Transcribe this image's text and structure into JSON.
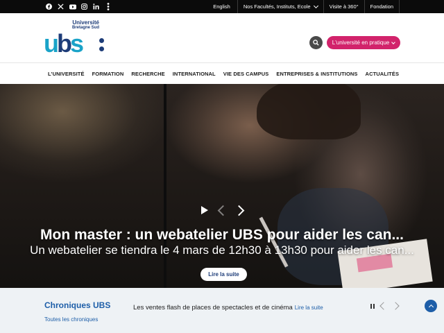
{
  "topbar": {
    "social": [
      "facebook-icon",
      "x-icon",
      "youtube-icon",
      "instagram-icon",
      "linkedin-icon",
      "more-icon"
    ],
    "links": [
      {
        "label": "English"
      },
      {
        "label": "Nos Facultés, Instituts, Ecole"
      },
      {
        "label": "Visite à 360°"
      },
      {
        "label": "Fondation"
      }
    ]
  },
  "header": {
    "logo": {
      "line1": "Université",
      "line2": "Bretagne Sud",
      "word_u": "u",
      "word_b": "b",
      "word_s": "s"
    },
    "cta_label": "L'université en pratique"
  },
  "nav": {
    "items": [
      "L'UNIVERSITÉ",
      "FORMATION",
      "RECHERCHE",
      "INTERNATIONAL",
      "VIE DES CAMPUS",
      "ENTREPRISES & INSTITUTIONS",
      "ACTUALITÉS"
    ]
  },
  "hero": {
    "title": "Mon master : un webatelier UBS pour aider les can...",
    "subtitle": "Un webatelier se tiendra le 4 mars de 12h30 à 13h30 pour aider les can...",
    "button_label": "Lire la suite"
  },
  "chroniques": {
    "title": "Chroniques UBS",
    "all_link": "Toutes les chroniques",
    "item_text": "Les ventes flash de places de spectacles et de cinéma",
    "item_more": "Lire la suite"
  },
  "colors": {
    "accent_pink": "#d2236b",
    "brand_blue": "#1d3c78",
    "brand_cyan": "#1aa3c8",
    "link_blue": "#1d5ea8"
  }
}
